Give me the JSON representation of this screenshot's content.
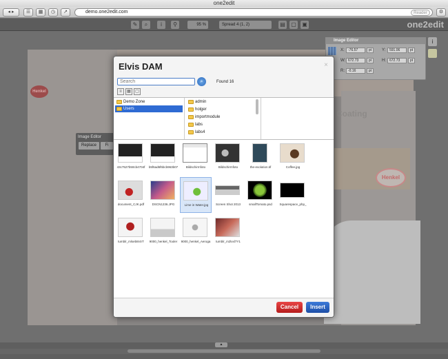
{
  "window": {
    "title": "one2edit"
  },
  "browser": {
    "url": "demo.one2edit.com",
    "reader_label": "Reader"
  },
  "app_toolbar": {
    "zoom": "95 %",
    "spread": "Spread 4 (1, 2)",
    "brand": "one2edit"
  },
  "document": {
    "logo_text": "Henkel",
    "heading_text": "Coating",
    "image_editor_mini_title": "Image Editor",
    "replace_label": "Replace",
    "fit_label": "Fi"
  },
  "image_editor": {
    "title": "Image Editor",
    "x_label": "X:",
    "x_value": "-76.57",
    "x_unit": "pt",
    "y_label": "Y:",
    "y_value": "591.06",
    "y_unit": "pt",
    "w_label": "W:",
    "w_value": "672.73",
    "w_unit": "pt",
    "h_label": "H:",
    "h_value": "672.73",
    "h_unit": "pt",
    "r_label": "R:",
    "r_value": "-0.16",
    "r_unit": "pt"
  },
  "modal": {
    "title": "Elvis DAM",
    "close": "×",
    "search_placeholder": "Search",
    "found_text": "Found 16",
    "folders_col1": [
      {
        "label": "Demo Zone",
        "selected": false
      },
      {
        "label": "Users",
        "selected": true
      }
    ],
    "folders_col2": [
      "admin",
      "holger",
      "importmodule",
      "labs",
      "labs4"
    ],
    "assets": [
      {
        "label": "43c7527b50cb4704f"
      },
      {
        "label": "b5f6ad6f6bcb963b07"
      },
      {
        "label": "Bildschirmfoto"
      },
      {
        "label": "Bildschirmfoto"
      },
      {
        "label": "the-evolution.tif"
      },
      {
        "label": "Coffee.jpg"
      },
      {
        "label": "document_CJK.pdf"
      },
      {
        "label": "DSCN1236.JPG"
      },
      {
        "label": "Lime in Water.jpg",
        "selected": true
      },
      {
        "label": "Screen Shot 2013"
      },
      {
        "label": "smallTomato.psd"
      },
      {
        "label": "Squarespace_php_"
      },
      {
        "label": "tumblr_mlseb8r4rT"
      },
      {
        "label": "9000_henkel_Tooler"
      },
      {
        "label": "9000_henkel_Aeroga"
      },
      {
        "label": "tumblr_m2lvxl7Y1"
      }
    ],
    "cancel_label": "Cancel",
    "insert_label": "Insert"
  },
  "colors": {
    "accent_blue": "#2f6bd3",
    "cancel_red": "#d32f2f",
    "insert_blue": "#2a5fb8"
  }
}
